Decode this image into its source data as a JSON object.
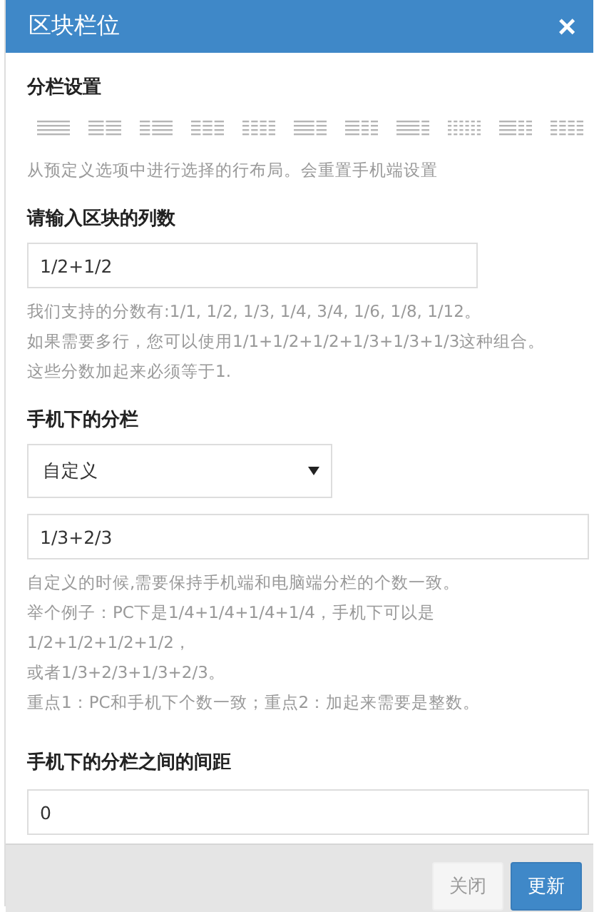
{
  "window": {
    "title": "区块栏位",
    "close": "×"
  },
  "layout_section": {
    "title": "分栏设置",
    "description": "从预定义选项中进行选择的行布局。会重置手机端设置"
  },
  "columns_field": {
    "label": "请输入区块的列数",
    "value": "1/2+1/2",
    "help": [
      "我们支持的分数有:1/1, 1/2, 1/3, 1/4, 3/4, 1/6, 1/8, 1/12。",
      "如果需要多行，您可以使用1/1+1/2+1/2+1/3+1/3+1/3这种组合。",
      "这些分数加起来必须等于1."
    ]
  },
  "mobile_columns": {
    "label": "手机下的分栏",
    "select_value": "自定义",
    "value": "1/3+2/3",
    "help": [
      "自定义的时候,需要保持手机端和电脑端分栏的个数一致。",
      "举个例子：PC下是1/4+1/4+1/4+1/4，手机下可以是1/2+1/2+1/2+1/2，",
      "或者1/3+2/3+1/3+2/3。",
      "重点1：PC和手机下个数一致；重点2：加起来需要是整数。"
    ]
  },
  "mobile_gap": {
    "label": "手机下的分栏之间的间距",
    "value": "0"
  },
  "buttons": [
    {
      "label": "关闭",
      "kind": "secondary"
    },
    {
      "label": "更新",
      "kind": "primary"
    }
  ]
}
